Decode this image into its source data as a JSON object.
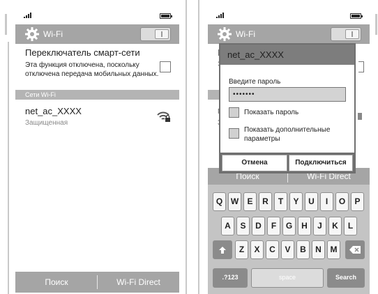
{
  "colors": {
    "bar_gray": "#a5a5a5",
    "section_gray": "#b4b4b4",
    "dialog_title": "#7d7d7d",
    "keyboard_bg": "#c4c4c4"
  },
  "left_screen": {
    "title": "Wi-Fi",
    "toggle_state": "on",
    "smart_network": {
      "title": "Переключатель смарт-сети",
      "description": "Эта функция отключена, поскольку отключена передача мобильных данных."
    },
    "section_header": "Сети Wi-Fi",
    "network": {
      "name": "net_ac_XXXX",
      "status": "Защищенная",
      "icon": "wifi-lock-icon"
    },
    "bottom": {
      "search": "Поиск",
      "wifi_direct": "Wi-Fi Direct"
    }
  },
  "right_screen": {
    "title": "Wi-Fi",
    "dialog": {
      "title": "net_ac_XXXX",
      "password_label": "Введите пароль",
      "password_value": "•••••••",
      "show_password": "Показать пароль",
      "show_advanced": "Показать дополнительные параметры",
      "cancel": "Отмена",
      "connect": "Подключиться"
    },
    "bottom": {
      "search": "Поиск",
      "wifi_direct": "Wi-Fi Direct"
    },
    "keyboard": {
      "row1": [
        "Q",
        "W",
        "E",
        "R",
        "T",
        "Y",
        "U",
        "I",
        "O",
        "P"
      ],
      "row2": [
        "A",
        "S",
        "D",
        "F",
        "G",
        "H",
        "J",
        "K",
        "L"
      ],
      "row3": [
        "Z",
        "X",
        "C",
        "V",
        "B",
        "N",
        "M"
      ],
      "sym_key": ".?123",
      "space_key": "space",
      "search_key": "Search",
      "shift_icon": "shift-icon",
      "backspace_icon": "backspace-icon"
    }
  }
}
